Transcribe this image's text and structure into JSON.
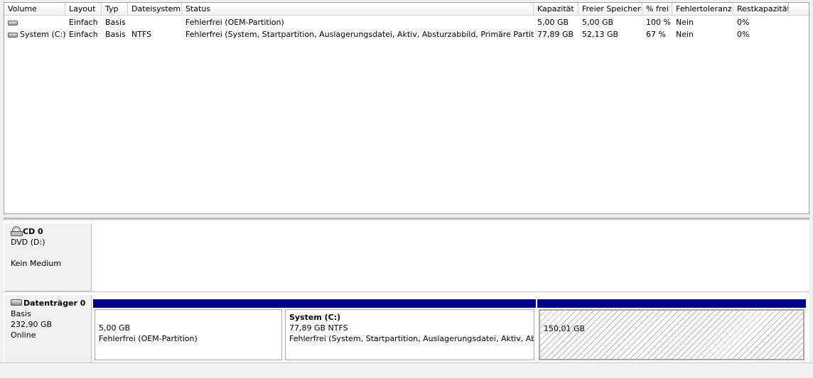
{
  "volumes": {
    "columns": [
      "Volume",
      "Layout",
      "Typ",
      "Dateisystem",
      "Status",
      "Kapazität",
      "Freier Speicher",
      "% frei",
      "Fehlertoleranz",
      "Restkapazität"
    ],
    "rows": [
      {
        "volume": "",
        "layout": "Einfach",
        "typ": "Basis",
        "dateisystem": "",
        "status": "Fehlerfrei (OEM-Partition)",
        "kapazitaet": "5,00 GB",
        "frei": "5,00 GB",
        "prozent": "100 %",
        "fehlertoleranz": "Nein",
        "rest": "0%"
      },
      {
        "volume": "System (C:)",
        "layout": "Einfach",
        "typ": "Basis",
        "dateisystem": "NTFS",
        "status": "Fehlerfrei (System, Startpartition, Auslagerungsdatei, Aktiv, Absturzabbild, Primäre Partition)",
        "kapazitaet": "77,89 GB",
        "frei": "52,13 GB",
        "prozent": "67 %",
        "fehlertoleranz": "Nein",
        "rest": "0%"
      }
    ]
  },
  "cd0": {
    "title": "CD 0",
    "line1": "DVD (D:)",
    "line2": "Kein Medium"
  },
  "disk0": {
    "title": "Datenträger 0",
    "type": "Basis",
    "size": "232,90 GB",
    "state": "Online",
    "partitions": [
      {
        "name": "",
        "size": "5,00 GB",
        "status": "Fehlerfrei (OEM-Partition)"
      },
      {
        "name": "System  (C:)",
        "size": "77,89 GB NTFS",
        "status": "Fehlerfrei (System, Startpartition, Auslagerungsdatei, Aktiv, Absturzabbild, Primäre Partition)"
      },
      {
        "name": "",
        "size": "150,01 GB",
        "status": ""
      }
    ]
  },
  "colors": {
    "partition_bar": "#00008b",
    "unallocated_bar": "#00008b"
  },
  "icons": {
    "volume": "drive-icon",
    "cd": "cd-drive-icon",
    "disk": "hard-disk-icon"
  }
}
